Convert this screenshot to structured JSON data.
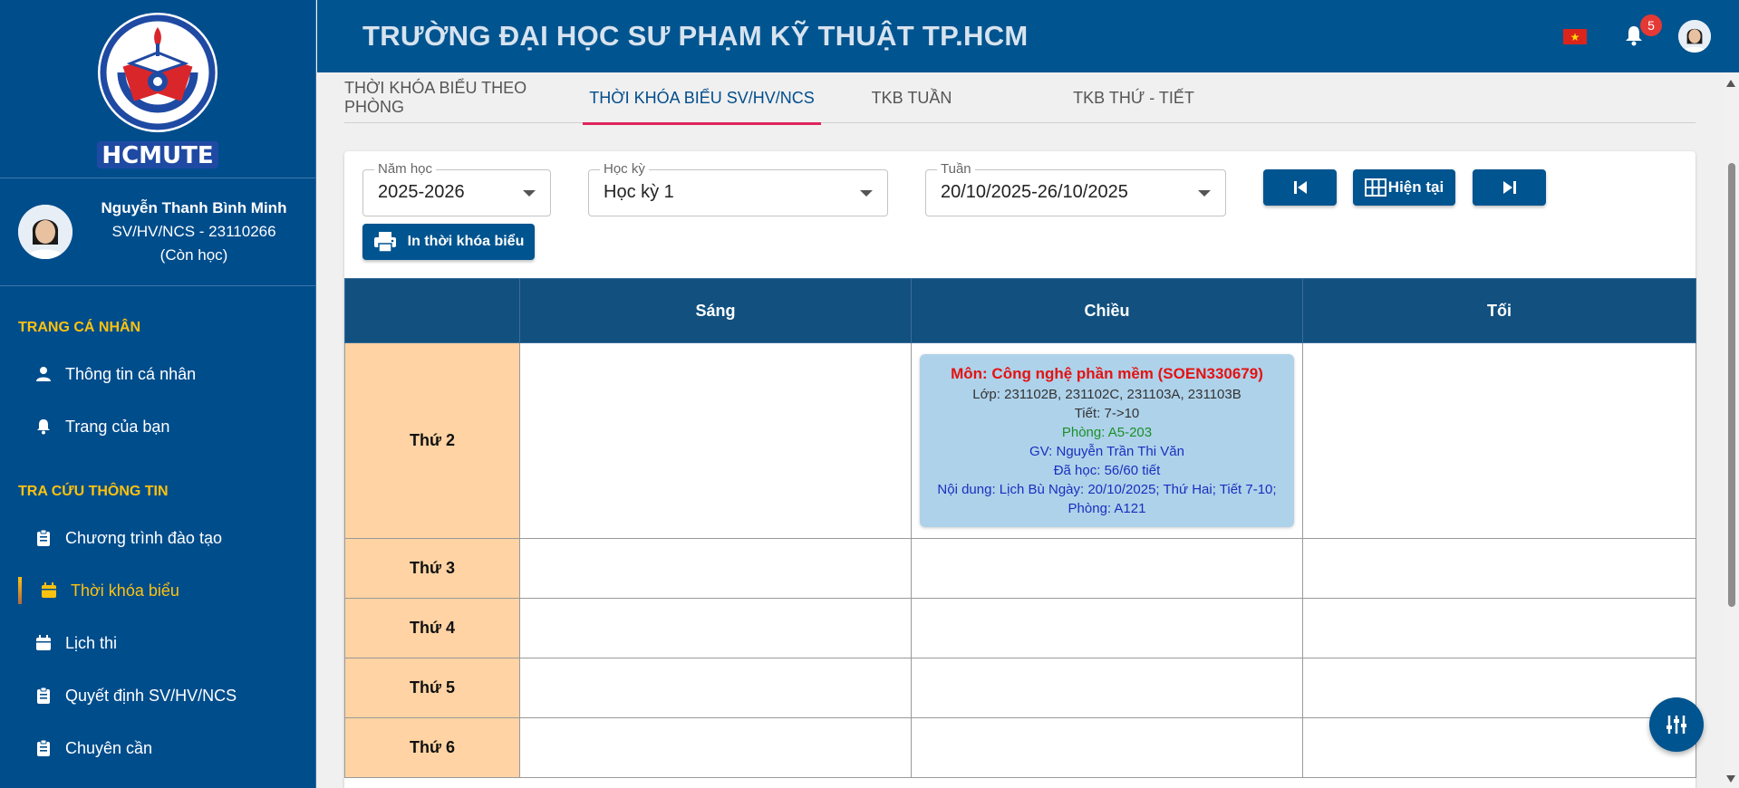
{
  "header": {
    "site_title": "TRƯỜNG ĐẠI HỌC SƯ PHẠM KỸ THUẬT TP.HCM",
    "notification_count": "5",
    "language_icon": "vietnam-flag-icon"
  },
  "sidebar": {
    "logo_text": "HCMUTE",
    "profile": {
      "name": "Nguyễn Thanh Bình Minh",
      "id_line": "SV/HV/NCS - 23110266",
      "status": "(Còn học)"
    },
    "sections": [
      {
        "title": "TRANG CÁ NHÂN",
        "items": [
          {
            "label": "Thông tin cá nhân",
            "icon": "person-icon"
          },
          {
            "label": "Trang của bạn",
            "icon": "bell-icon"
          }
        ]
      },
      {
        "title": "TRA CỨU THÔNG TIN",
        "items": [
          {
            "label": "Chương trình đào tạo",
            "icon": "clipboard-icon"
          },
          {
            "label": "Thời khóa biểu",
            "icon": "calendar-icon",
            "active": true
          },
          {
            "label": "Lịch thi",
            "icon": "calendar-icon"
          },
          {
            "label": "Quyết định SV/HV/NCS",
            "icon": "clipboard-icon"
          },
          {
            "label": "Chuyên cần",
            "icon": "clipboard-icon"
          }
        ]
      }
    ]
  },
  "tabs": [
    {
      "label": "THỜI KHÓA BIỂU THEO PHÒNG"
    },
    {
      "label": "THỜI KHÓA BIỂU SV/HV/NCS",
      "active": true
    },
    {
      "label": "TKB TUẦN"
    },
    {
      "label": "TKB THỨ - TIẾT"
    }
  ],
  "filters": {
    "year": {
      "label": "Năm học",
      "value": "2025-2026"
    },
    "semester": {
      "label": "Học kỳ",
      "value": "Học kỳ 1"
    },
    "week": {
      "label": "Tuần",
      "value": "20/10/2025-26/10/2025"
    }
  },
  "buttons": {
    "current": "Hiện tại",
    "print": "In thời khóa biểu"
  },
  "schedule": {
    "columns": [
      "",
      "Sáng",
      "Chiều",
      "Tối"
    ],
    "days": [
      "Thứ 2",
      "Thứ 3",
      "Thứ 4",
      "Thứ 5",
      "Thứ 6"
    ],
    "event": {
      "title": "Môn: Công nghệ phần mềm (SOEN330679)",
      "classes": "Lớp: 231102B, 231102C, 231103A, 231103B",
      "period": "Tiết: 7->10",
      "room": "Phòng: A5-203",
      "lecturer": "GV: Nguyễn Trần Thi Văn",
      "progress": "Đã học: 56/60 tiết",
      "content": "Nội dung: Lịch Bù Ngày: 20/10/2025; Thứ Hai; Tiết 7-10;",
      "content_room": "Phòng: A121"
    }
  },
  "colors": {
    "primary": "#00548f",
    "accent": "#ffc20e",
    "day_cell": "#ffd3a3",
    "event_bg": "#aed2ea",
    "tab_indicator": "#e0245e"
  }
}
